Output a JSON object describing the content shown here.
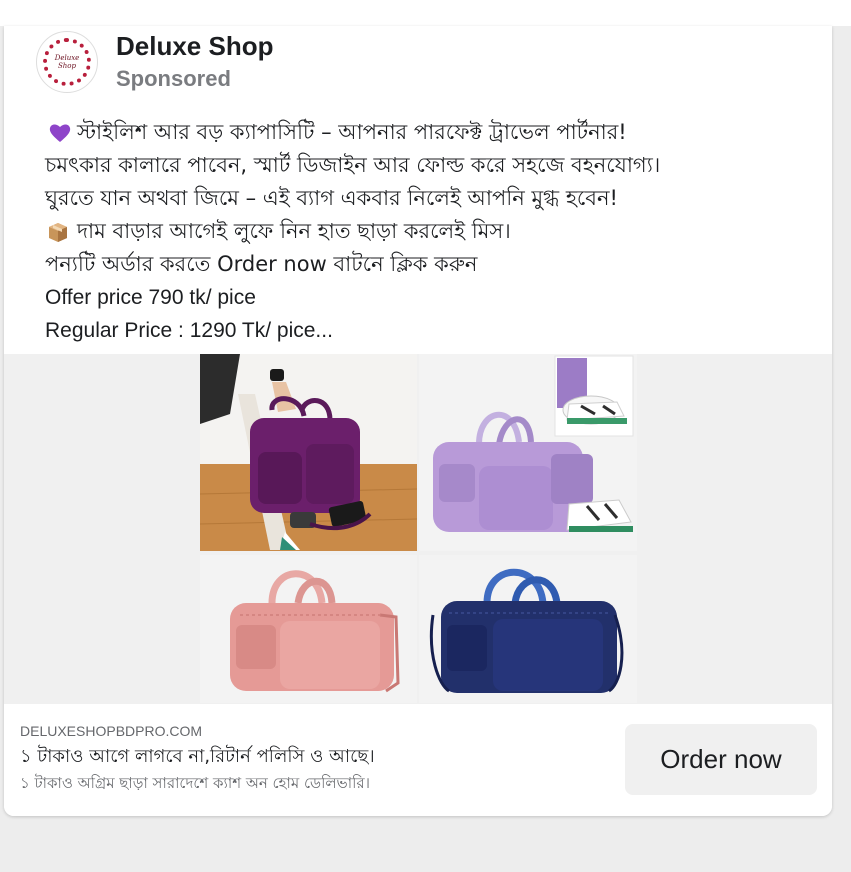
{
  "post": {
    "shop_name": "Deluxe Shop",
    "sponsored_label": "Sponsored",
    "avatar_text": "Deluxe Shop",
    "lines": [
      "স্টাইলিশ আর বড় ক্যাপাসিটি – আপনার পারফেক্ট ট্রাভেল পার্টনার!",
      "চমৎকার কালারে পাবেন, স্মার্ট ডিজাইন আর ফোল্ড করে সহজে বহনযোগ্য।",
      "ঘুরতে যান অথবা জিমে – এই ব্যাগ একবার নিলেই আপনি মুগ্ধ হবেন!",
      "দাম বাড়ার আগেই লুফে নিন হাত ছাড়া করলেই মিস।",
      "পন্যটি অর্ডার করতে  Order now বাটনে ক্লিক করুন",
      "Offer price 790 tk/ pice",
      "Regular Price : 1290 Tk/ pice..."
    ],
    "line_icons": [
      "purple-heart-icon",
      "",
      "",
      "package-icon",
      "",
      "",
      ""
    ]
  },
  "media": {
    "photos": [
      {
        "name": "photo-purple-bag-held",
        "bag_color": "#6b1f6b"
      },
      {
        "name": "photo-lavender-bag-shoes",
        "bag_color": "#b89ad8"
      },
      {
        "name": "photo-pink-bag",
        "bag_color": "#e59a96"
      },
      {
        "name": "photo-navy-bag",
        "bag_color": "#22306b"
      }
    ]
  },
  "link_footer": {
    "domain": "DELUXESHOPBDPRO.COM",
    "title": "১ টাকাও আগে লাগবে না,রিটার্ন পলিসি ও আছে।",
    "subtitle": "১ টাকাও অগ্রিম ছাড়া সারাদেশে ক্যাশ অন হোম ডেলিভারি।",
    "cta_label": "Order now"
  },
  "colors": {
    "brand_ring": "#b81f3c",
    "text_primary": "#1c1e21",
    "text_secondary": "#65676b",
    "button_bg": "#f0f0f0"
  }
}
